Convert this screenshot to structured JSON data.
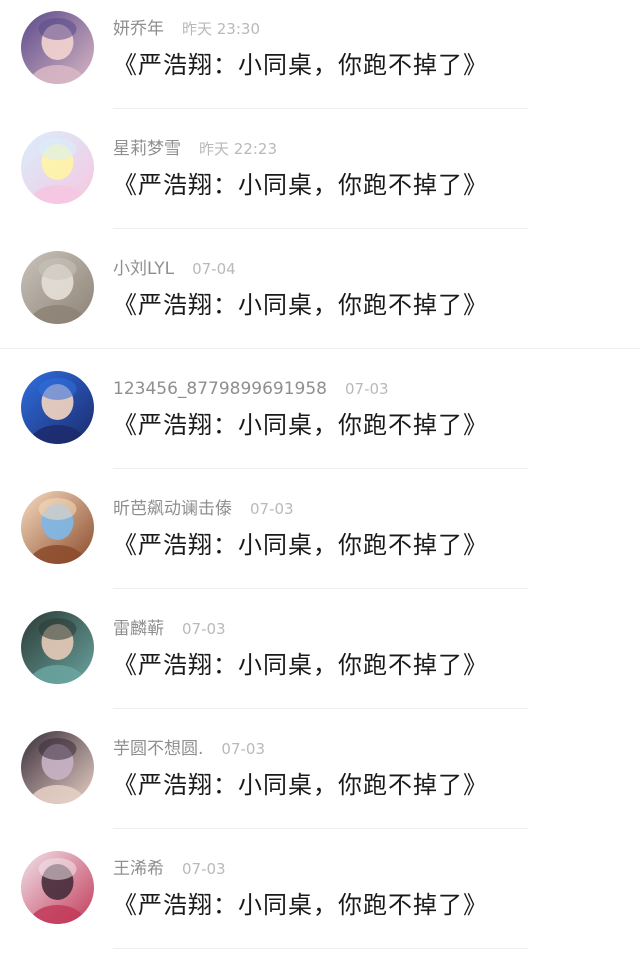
{
  "messages": [
    {
      "name": "妍乔年",
      "time": "昨天 23:30",
      "text": "《严浩翔：小同桌，你跑不掉了》",
      "avatar": "avatar-girl-peace-sign",
      "avatar_colors": [
        "#5a4a8a",
        "#d9b7c4",
        "#f2d3cf"
      ]
    },
    {
      "name": "星莉梦雪",
      "time": "昨天 22:23",
      "text": "《严浩翔：小同桌，你跑不掉了》",
      "avatar": "avatar-anime-girl-pastel",
      "avatar_colors": [
        "#d8eefc",
        "#f7c6e0",
        "#fff3a8"
      ]
    },
    {
      "name": "小刘LYL",
      "time": "07-04",
      "text": "《严浩翔：小同桌，你跑不掉了》",
      "avatar": "avatar-braided-hair-girl",
      "avatar_colors": [
        "#c9c3bb",
        "#8d8275",
        "#e4ded6"
      ]
    },
    {
      "name": "123456_8779899691958",
      "time": "07-03",
      "text": "《严浩翔：小同桌，你跑不掉了》",
      "avatar": "avatar-boy-blue-sunglasses",
      "avatar_colors": [
        "#2f6fe0",
        "#1c2a6b",
        "#f0d2c0"
      ]
    },
    {
      "name": "昕芭飙动谰击傣",
      "time": "07-03",
      "text": "《严浩翔：小同桌，你跑不掉了》",
      "avatar": "avatar-cartoon-boy-cap",
      "avatar_colors": [
        "#f6dcc0",
        "#8b4a2b",
        "#7fb7e6"
      ]
    },
    {
      "name": "雷麟蕲",
      "time": "07-03",
      "text": "《严浩翔：小同桌，你跑不掉了》",
      "avatar": "avatar-boy-dark-portrait",
      "avatar_colors": [
        "#2b3a35",
        "#6aa4a0",
        "#e3c8b5"
      ]
    },
    {
      "name": "芋圆不想圆.",
      "time": "07-03",
      "text": "《严浩翔：小同桌，你跑不掉了》",
      "avatar": "avatar-blonde-girl-dark",
      "avatar_colors": [
        "#3a2e3a",
        "#e8d0c6",
        "#c6b2c4"
      ]
    },
    {
      "name": "王浠希",
      "time": "07-03",
      "text": "《严浩翔：小同桌，你跑不掉了》",
      "avatar": "avatar-anime-girl-roses",
      "avatar_colors": [
        "#f1e3ea",
        "#c23b5a",
        "#4a2f3c"
      ]
    }
  ]
}
